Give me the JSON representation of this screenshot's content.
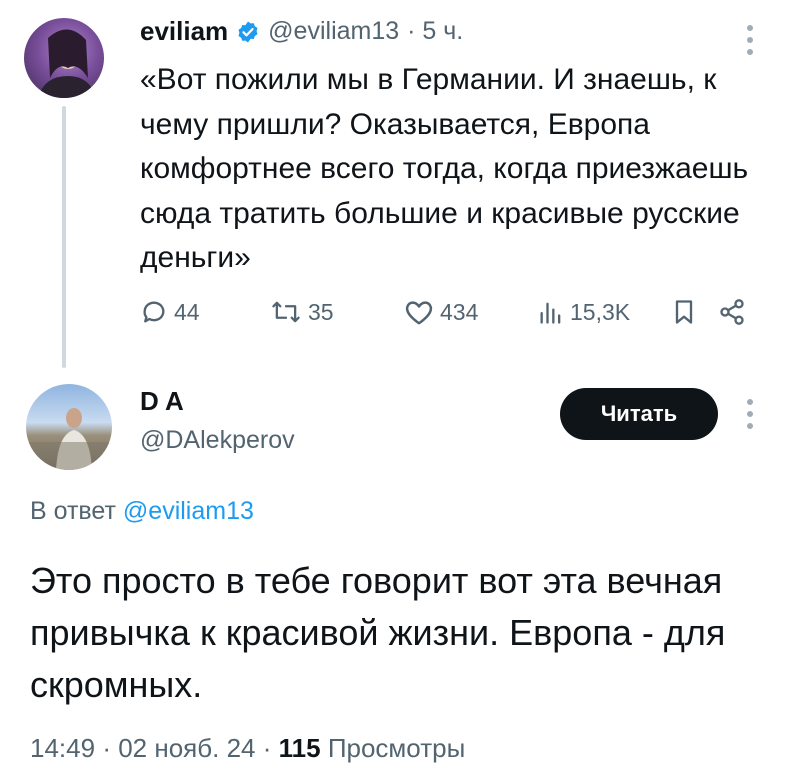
{
  "tweet": {
    "author_name": "eviliam",
    "verified_icon": "verified-badge-icon",
    "handle": "@eviliam13",
    "time": "· 5 ч.",
    "text": "«Вот пожили мы в Германии. И знаешь, к чему пришли? Оказывается, Европа комфортнее всего тогда, когда приезжаешь сюда тратить большие и красивые русские деньги»",
    "actions": {
      "replies": "44",
      "retweets": "35",
      "likes": "434",
      "views": "15,3K"
    }
  },
  "reply": {
    "author_name": "D A",
    "handle": "@DAlekperov",
    "follow_label": "Читать",
    "reply_prefix": "В ответ",
    "reply_to_handle": "@eviliam13",
    "text": "Это просто в тебе говорит вот эта вечная привычка к красивой жизни. Европа - для скромных.",
    "time": "14:49",
    "date": "02 нояб. 24",
    "views_count": "115",
    "views_label": "Просмотры"
  },
  "colors": {
    "text": "#0f1419",
    "secondary": "#536471",
    "link": "#1d9bf0",
    "verified": "#1d9bf0",
    "button_bg": "#0f1419"
  }
}
